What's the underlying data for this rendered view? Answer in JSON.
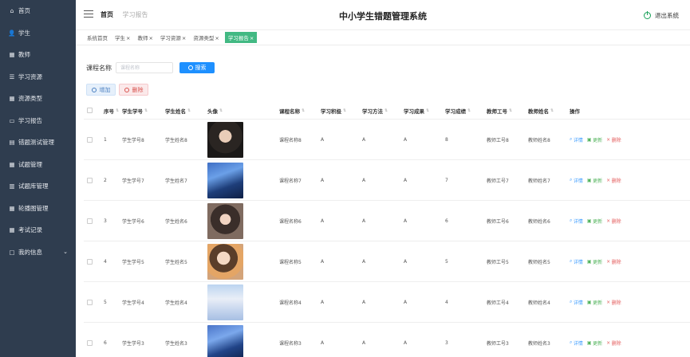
{
  "app": {
    "title": "中小学生错题管理系统",
    "logout": "退出系统"
  },
  "breadcrumb": {
    "home": "首页",
    "current": "学习报告"
  },
  "sidebar": {
    "items": [
      {
        "label": "首页",
        "icon": "home-icon",
        "glyph": "⌂"
      },
      {
        "label": "学生",
        "icon": "user-icon",
        "glyph": "👤"
      },
      {
        "label": "教师",
        "icon": "grid-icon",
        "glyph": "▦"
      },
      {
        "label": "学习资源",
        "icon": "sliders-icon",
        "glyph": "☰"
      },
      {
        "label": "资源类型",
        "icon": "grid-icon",
        "glyph": "▦"
      },
      {
        "label": "学习报告",
        "icon": "chat-icon",
        "glyph": "▭"
      },
      {
        "label": "错题测试管理",
        "icon": "file-icon",
        "glyph": "▤"
      },
      {
        "label": "试题管理",
        "icon": "grid-icon",
        "glyph": "▦"
      },
      {
        "label": "试题库管理",
        "icon": "chart-icon",
        "glyph": "▥"
      },
      {
        "label": "轮播图管理",
        "icon": "grid-icon",
        "glyph": "▦"
      },
      {
        "label": "考试记录",
        "icon": "grid-icon",
        "glyph": "▦"
      },
      {
        "label": "我的信息",
        "icon": "window-icon",
        "glyph": "▢",
        "chevron": "⌄"
      }
    ]
  },
  "tags": [
    {
      "label": "系统首页",
      "closable": false
    },
    {
      "label": "学生",
      "closable": true
    },
    {
      "label": "教师",
      "closable": true
    },
    {
      "label": "学习资源",
      "closable": true
    },
    {
      "label": "资源类型",
      "closable": true
    },
    {
      "label": "学习报告",
      "closable": true,
      "active": true
    }
  ],
  "search": {
    "label": "课程名称",
    "placeholder": "课程名称",
    "button": "搜索"
  },
  "toolbar": {
    "add": "增加",
    "delete": "删除"
  },
  "table": {
    "columns": [
      "序号",
      "学生学号",
      "学生姓名",
      "头像",
      "课程名称",
      "学习积极",
      "学习方法",
      "学习成果",
      "学习成绩",
      "教师工号",
      "教师姓名",
      "操作"
    ],
    "rows": [
      {
        "index": "1",
        "student_no": "学生学号8",
        "student_name": "学生姓名8",
        "course": "课程名称8",
        "m1": "A",
        "m2": "A",
        "m3": "A",
        "m4": "8",
        "teacher_no": "教师工号8",
        "teacher_name": "教师姓名8"
      },
      {
        "index": "2",
        "student_no": "学生学号7",
        "student_name": "学生姓名7",
        "course": "课程名称7",
        "m1": "A",
        "m2": "A",
        "m3": "A",
        "m4": "7",
        "teacher_no": "教师工号7",
        "teacher_name": "教师姓名7"
      },
      {
        "index": "3",
        "student_no": "学生学号6",
        "student_name": "学生姓名6",
        "course": "课程名称6",
        "m1": "A",
        "m2": "A",
        "m3": "A",
        "m4": "6",
        "teacher_no": "教师工号6",
        "teacher_name": "教师姓名6"
      },
      {
        "index": "4",
        "student_no": "学生学号5",
        "student_name": "学生姓名5",
        "course": "课程名称5",
        "m1": "A",
        "m2": "A",
        "m3": "A",
        "m4": "5",
        "teacher_no": "教师工号5",
        "teacher_name": "教师姓名5"
      },
      {
        "index": "5",
        "student_no": "学生学号4",
        "student_name": "学生姓名4",
        "course": "课程名称4",
        "m1": "A",
        "m2": "A",
        "m3": "A",
        "m4": "4",
        "teacher_no": "教师工号4",
        "teacher_name": "教师姓名4"
      },
      {
        "index": "6",
        "student_no": "学生学号3",
        "student_name": "学生姓名3",
        "course": "课程名称3",
        "m1": "A",
        "m2": "A",
        "m3": "A",
        "m4": "3",
        "teacher_no": "教师工号3",
        "teacher_name": "教师姓名3"
      }
    ],
    "row_actions": {
      "detail": "详情",
      "edit": "更新",
      "remove": "删除"
    }
  }
}
